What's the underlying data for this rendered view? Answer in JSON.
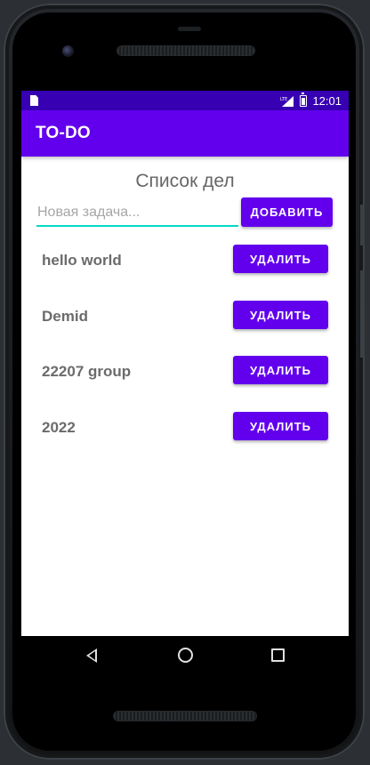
{
  "status_bar": {
    "time": "12:01",
    "network_label": "LTE",
    "icons": [
      "sim-card-icon",
      "lte-signal-icon",
      "battery-icon"
    ]
  },
  "app_bar": {
    "title": "TO-DO"
  },
  "main": {
    "heading": "Список дел",
    "new_task": {
      "value": "",
      "placeholder": "Новая задача..."
    },
    "add_button_label": "ДОБАВИТЬ",
    "tasks": [
      {
        "text": "hello world",
        "delete_label": "УДАЛИТЬ"
      },
      {
        "text": "Demid",
        "delete_label": "УДАЛИТЬ"
      },
      {
        "text": "22207 group",
        "delete_label": "УДАЛИТЬ"
      },
      {
        "text": "2022",
        "delete_label": "УДАЛИТЬ"
      }
    ]
  },
  "nav_bar": {
    "icons": [
      "back-icon",
      "home-icon",
      "recents-icon"
    ]
  },
  "colors": {
    "status_bar": "#3700b3",
    "primary": "#6200ee",
    "input_underline": "#03dac5",
    "task_text": "#6b6b6b"
  }
}
